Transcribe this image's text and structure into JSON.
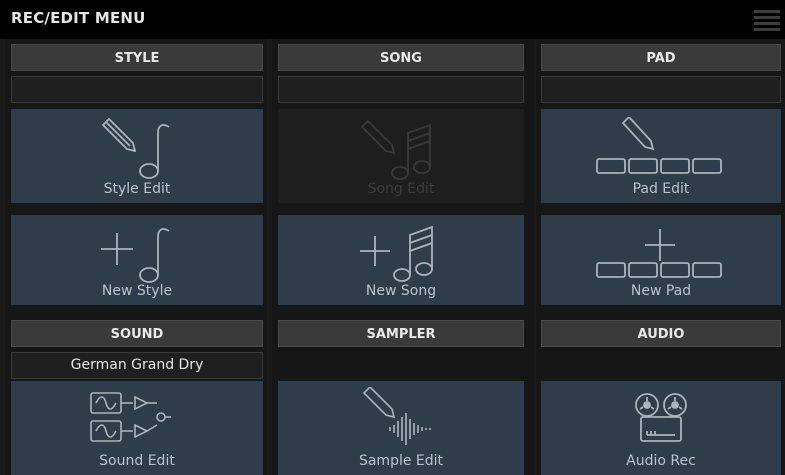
{
  "title": "REC/EDIT MENU",
  "menu_icon": "list-icon",
  "sections": {
    "style": {
      "header": "STYLE",
      "slot": "",
      "tile1": "Style Edit",
      "tile2": "New Style"
    },
    "song": {
      "header": "SONG",
      "slot": "",
      "tile1": "Song Edit",
      "tile2": "New Song"
    },
    "pad": {
      "header": "PAD",
      "slot": "",
      "tile1": "Pad Edit",
      "tile2": "New Pad"
    },
    "sound": {
      "header": "SOUND",
      "slot": "German Grand Dry",
      "tile": "Sound Edit"
    },
    "sampler": {
      "header": "SAMPLER",
      "tile": "Sample Edit"
    },
    "audio": {
      "header": "AUDIO",
      "tile": "Audio Rec"
    }
  },
  "colors": {
    "tile": "#2e3d49",
    "tile_disabled": "#1e1e1e",
    "header": "#3a3a3a",
    "background": "#161616"
  }
}
